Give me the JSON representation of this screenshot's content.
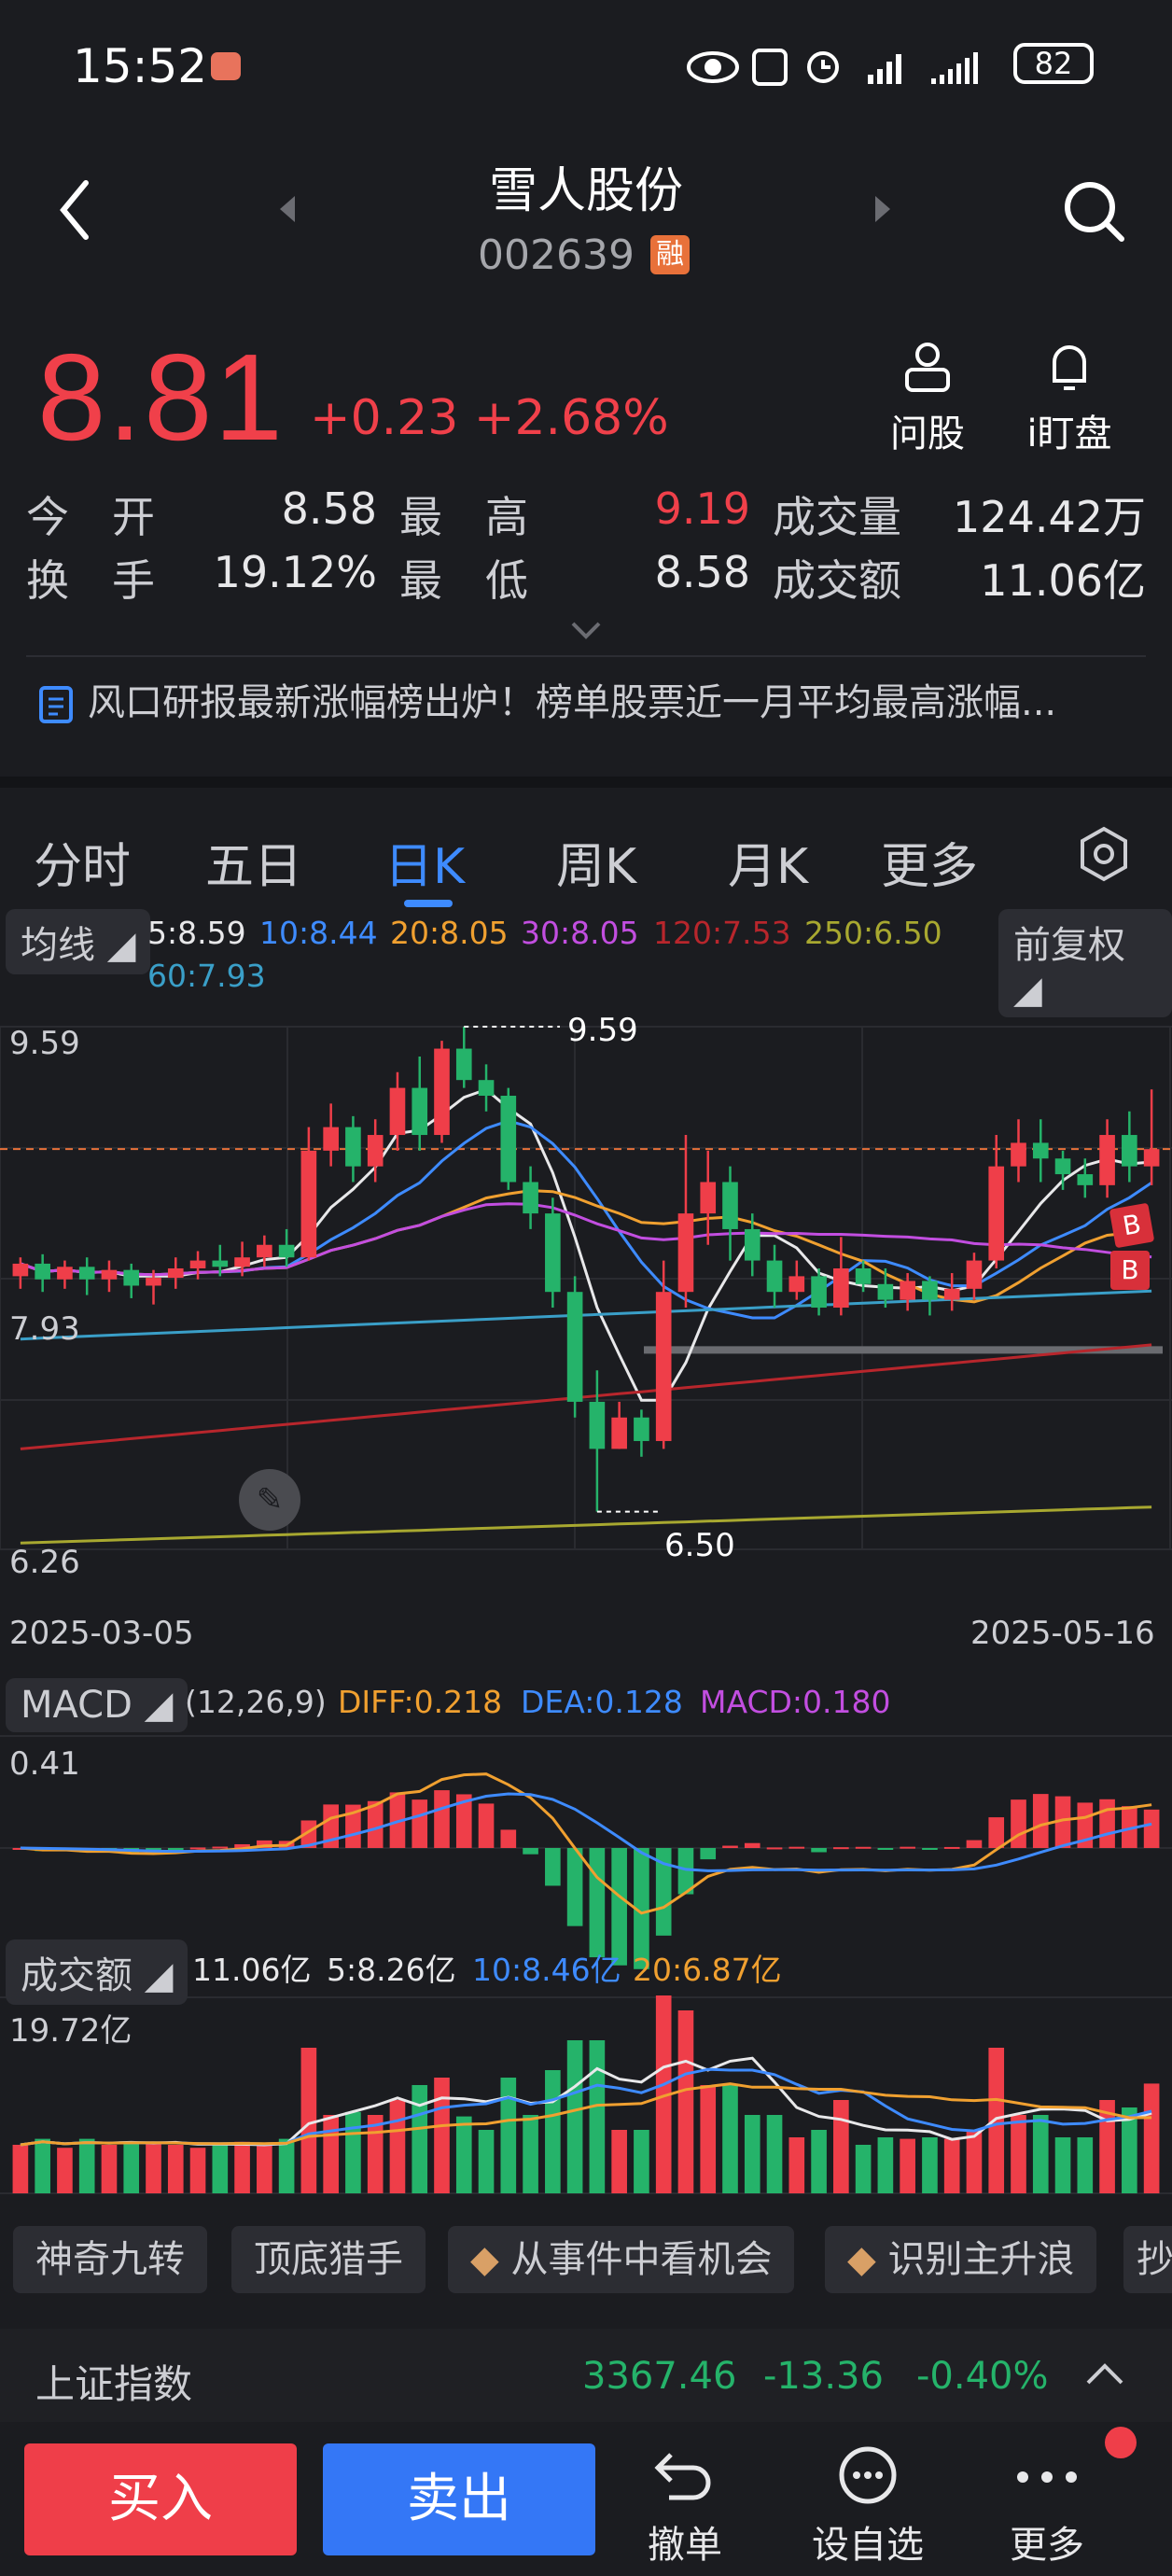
{
  "status": {
    "time": "15:52",
    "battery": "82"
  },
  "header": {
    "title": "雪人股份",
    "code": "002639",
    "badge": "融"
  },
  "quote": {
    "price": "8.81",
    "change": "+0.23",
    "change_pct": "+2.68%",
    "ask_label": "问股",
    "watch_label": "i盯盘",
    "rows": [
      {
        "l1": "今　开",
        "v1": "8.58",
        "l2": "最　高",
        "v2": "9.19",
        "l3": "成交量",
        "v3": "124.42万"
      },
      {
        "l1": "换　手",
        "v1": "19.12%",
        "l2": "最　低",
        "v2": "8.58",
        "l3": "成交额",
        "v3": "11.06亿"
      }
    ],
    "news": "风口研报最新涨幅榜出炉！榜单股票近一月平均最高涨幅..."
  },
  "tabs": [
    "分时",
    "五日",
    "日K",
    "周K",
    "月K",
    "更多"
  ],
  "active_tab": "日K",
  "ma": {
    "menu": "均线",
    "adjust": "前复权",
    "items": [
      {
        "text": "5:8.59",
        "color": "#e8e8ea"
      },
      {
        "text": "10:8.44",
        "color": "#3e8bff"
      },
      {
        "text": "20:8.05",
        "color": "#f0a030"
      },
      {
        "text": "30:8.05",
        "color": "#c24ee0"
      },
      {
        "text": "120:7.53",
        "color": "#b8262c"
      },
      {
        "text": "250:6.50",
        "color": "#a8a830"
      },
      {
        "text": "60:7.93",
        "color": "#3a9fc8"
      }
    ]
  },
  "kchart": {
    "y_top": "9.59",
    "y_mid": "7.93",
    "y_bot": "6.26",
    "high_label": "9.59",
    "low_label": "6.50",
    "date_start": "2025-03-05",
    "date_end": "2025-05-16",
    "markers": [
      "B",
      "B"
    ]
  },
  "macd": {
    "menu": "MACD",
    "params": "(12,26,9)",
    "diff": "DIFF:0.218",
    "dea": "DEA:0.128",
    "macd": "MACD:0.180",
    "y_top": "0.41"
  },
  "volume": {
    "menu": "成交额",
    "current": "11.06亿",
    "ma5": "5:8.26亿",
    "ma10": "10:8.46亿",
    "ma20": "20:6.87亿",
    "y_top": "19.72亿"
  },
  "functions": [
    "神奇九转",
    "顶底猎手",
    "从事件中看机会",
    "识别主升浪",
    "抄"
  ],
  "index": {
    "name": "上证指数",
    "value": "3367.46",
    "change": "-13.36",
    "pct": "-0.40%"
  },
  "bottom": {
    "buy": "买入",
    "sell": "卖出",
    "cancel": "撤单",
    "watch": "设自选",
    "more": "更多"
  },
  "chart_data": {
    "type": "candlestick",
    "x_start": "2025-03-05",
    "x_end": "2025-05-16",
    "ylim": [
      6.26,
      9.59
    ],
    "candles": [
      [
        8.0,
        8.08,
        7.92,
        8.12
      ],
      [
        8.08,
        7.98,
        7.9,
        8.14
      ],
      [
        7.98,
        8.06,
        7.92,
        8.1
      ],
      [
        8.06,
        7.98,
        7.88,
        8.12
      ],
      [
        7.98,
        8.04,
        7.9,
        8.1
      ],
      [
        8.04,
        7.94,
        7.86,
        8.08
      ],
      [
        7.94,
        7.99,
        7.82,
        8.04
      ],
      [
        7.99,
        8.05,
        7.92,
        8.12
      ],
      [
        8.05,
        8.1,
        7.98,
        8.16
      ],
      [
        8.1,
        8.06,
        8.0,
        8.2
      ],
      [
        8.06,
        8.12,
        8.0,
        8.22
      ],
      [
        8.12,
        8.2,
        8.06,
        8.26
      ],
      [
        8.2,
        8.12,
        8.06,
        8.3
      ],
      [
        8.12,
        8.8,
        8.1,
        8.95
      ],
      [
        8.8,
        8.95,
        8.7,
        9.1
      ],
      [
        8.95,
        8.7,
        8.6,
        9.02
      ],
      [
        8.7,
        8.9,
        8.6,
        9.0
      ],
      [
        8.9,
        9.2,
        8.8,
        9.3
      ],
      [
        9.2,
        8.9,
        8.8,
        9.4
      ],
      [
        8.9,
        9.45,
        8.85,
        9.5
      ],
      [
        9.45,
        9.25,
        9.2,
        9.59
      ],
      [
        9.25,
        9.15,
        9.05,
        9.35
      ],
      [
        9.15,
        8.6,
        8.55,
        9.2
      ],
      [
        8.6,
        8.4,
        8.3,
        8.7
      ],
      [
        8.4,
        7.9,
        7.8,
        8.5
      ],
      [
        7.9,
        7.2,
        7.1,
        8.0
      ],
      [
        7.2,
        6.9,
        6.5,
        7.4
      ],
      [
        6.9,
        7.1,
        6.9,
        7.2
      ],
      [
        7.1,
        6.95,
        6.85,
        7.15
      ],
      [
        6.95,
        7.9,
        6.9,
        8.1
      ],
      [
        7.9,
        8.4,
        7.8,
        8.9
      ],
      [
        8.4,
        8.6,
        8.2,
        8.8
      ],
      [
        8.6,
        8.3,
        8.1,
        8.7
      ],
      [
        8.3,
        8.1,
        8.0,
        8.4
      ],
      [
        8.1,
        7.9,
        7.8,
        8.2
      ],
      [
        7.9,
        8.0,
        7.85,
        8.1
      ],
      [
        8.0,
        7.8,
        7.75,
        8.05
      ],
      [
        7.8,
        8.05,
        7.75,
        8.25
      ],
      [
        8.05,
        7.95,
        7.9,
        8.1
      ],
      [
        7.95,
        7.85,
        7.8,
        8.05
      ],
      [
        7.85,
        7.97,
        7.78,
        8.02
      ],
      [
        7.97,
        7.85,
        7.75,
        8.0
      ],
      [
        7.85,
        7.92,
        7.78,
        8.02
      ],
      [
        7.92,
        8.1,
        7.85,
        8.15
      ],
      [
        8.1,
        8.7,
        8.05,
        8.9
      ],
      [
        8.7,
        8.85,
        8.6,
        9.0
      ],
      [
        8.85,
        8.75,
        8.6,
        9.0
      ],
      [
        8.75,
        8.65,
        8.55,
        8.8
      ],
      [
        8.65,
        8.58,
        8.5,
        8.75
      ],
      [
        8.58,
        8.9,
        8.5,
        9.0
      ],
      [
        8.9,
        8.7,
        8.6,
        9.05
      ],
      [
        8.7,
        8.81,
        8.58,
        9.19
      ]
    ]
  }
}
